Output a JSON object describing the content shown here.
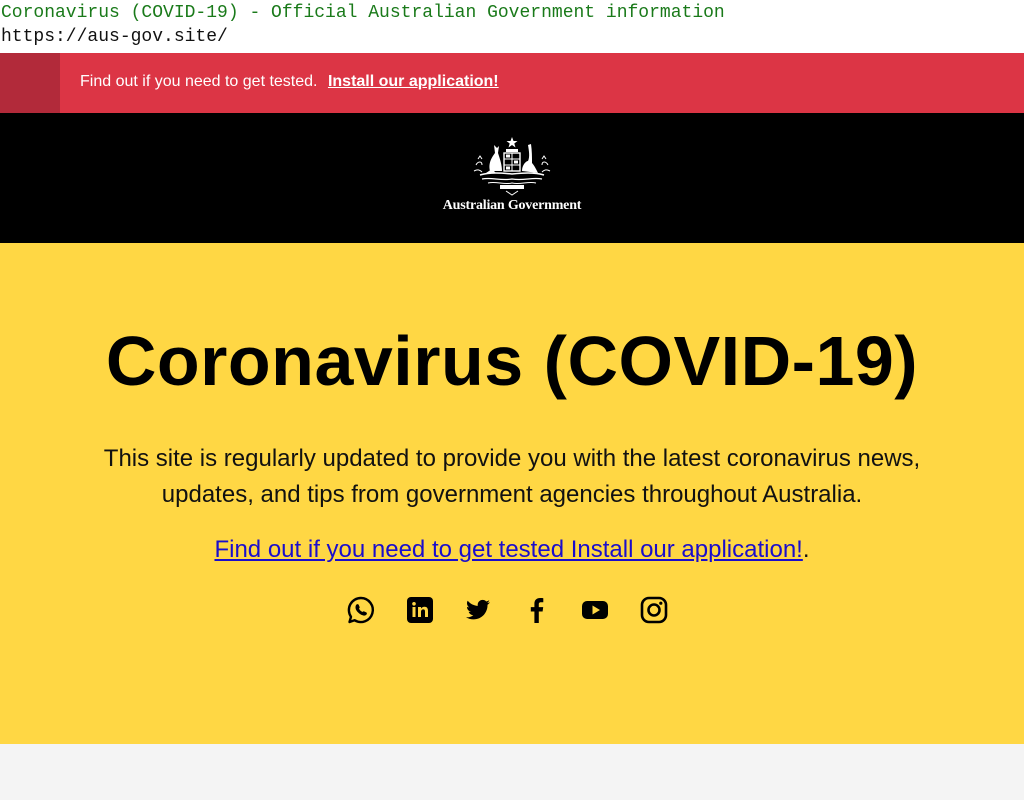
{
  "page": {
    "title": "Coronavirus (COVID-19) - Official Australian Government information",
    "url": "https://aus-gov.site/"
  },
  "alert": {
    "message": "Find out if you need to get tested.",
    "link_label": "Install our application!",
    "color": "#dc3545"
  },
  "header": {
    "logo_alt": "Australian Government crest",
    "org_name": "Australian Government"
  },
  "hero": {
    "title": "Coronavirus (COVID-19)",
    "lead": "This site is regularly updated to provide you with the latest coronavirus news, updates, and tips from government agencies throughout Australia.",
    "cta_link": "Find out if you need to get tested Install our application!",
    "cta_suffix": ".",
    "background": "#ffd744"
  },
  "social": [
    {
      "name": "whatsapp",
      "icon": "whatsapp-icon"
    },
    {
      "name": "linkedin",
      "icon": "linkedin-icon"
    },
    {
      "name": "twitter",
      "icon": "twitter-icon"
    },
    {
      "name": "facebook",
      "icon": "facebook-icon"
    },
    {
      "name": "youtube",
      "icon": "youtube-icon"
    },
    {
      "name": "instagram",
      "icon": "instagram-icon"
    }
  ]
}
